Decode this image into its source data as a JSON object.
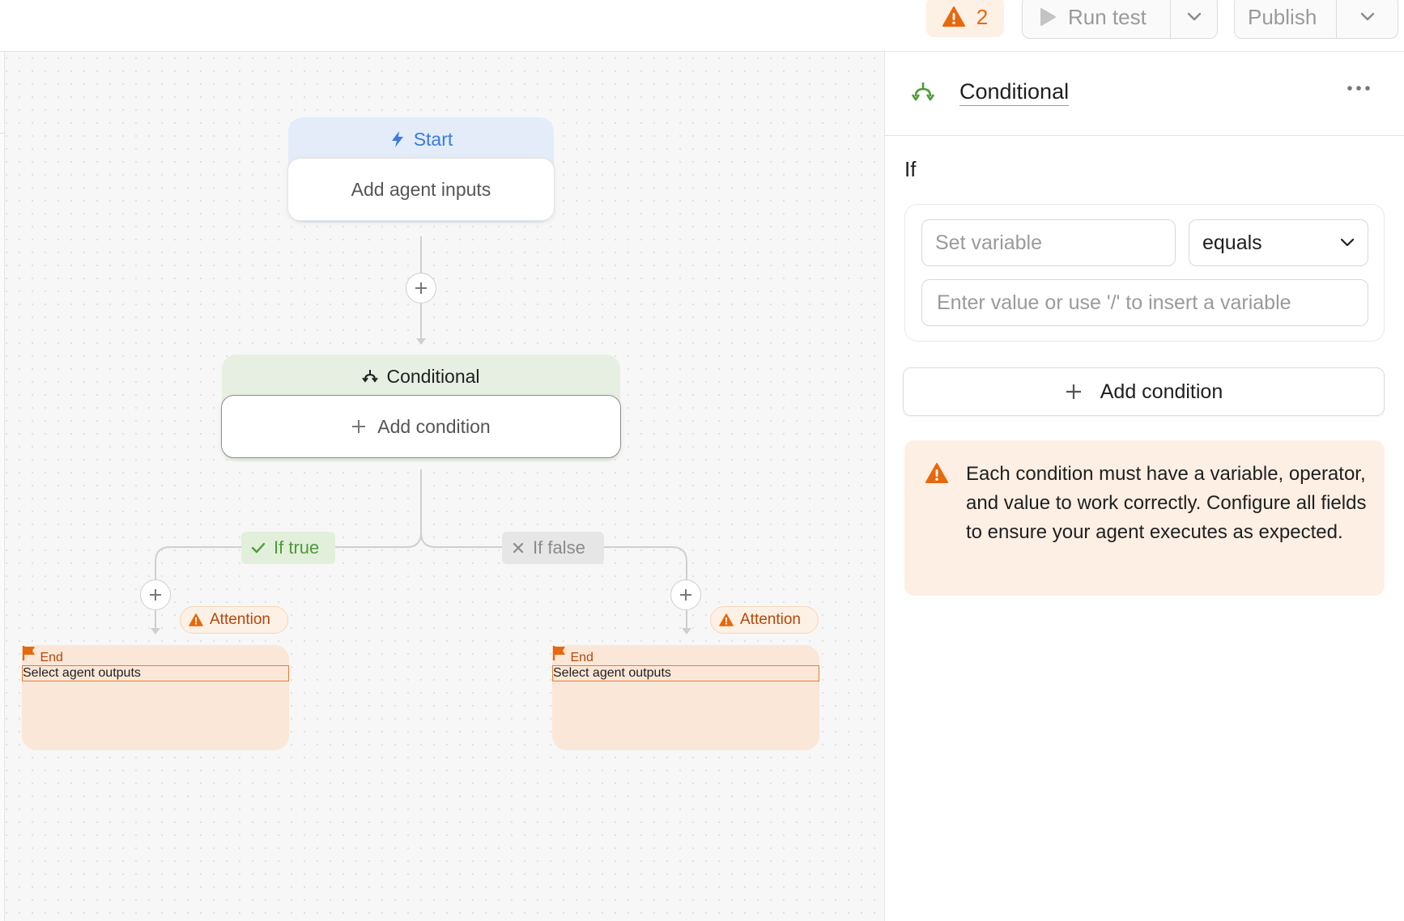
{
  "toolbar": {
    "warning_count": "2",
    "run_test_label": "Run test",
    "publish_label": "Publish"
  },
  "canvas": {
    "start": {
      "title": "Start",
      "body": "Add agent inputs"
    },
    "conditional": {
      "title": "Conditional",
      "body": "Add condition"
    },
    "branches": {
      "true_label": "If true",
      "false_label": "If false"
    },
    "attention_label": "Attention",
    "end_left": {
      "title": "End",
      "body": "Select agent outputs"
    },
    "end_right": {
      "title": "End",
      "body": "Select agent outputs"
    }
  },
  "panel": {
    "title": "Conditional",
    "if_label": "If",
    "variable_placeholder": "Set variable",
    "operator": "equals",
    "value_placeholder": "Enter value or use '/' to insert a variable",
    "add_condition_label": "Add condition",
    "warning_text": "Each condition must have a variable, operator, and value to work correctly. Configure all fields to ensure your agent executes as expected."
  },
  "colors": {
    "accent_orange": "#e8680c",
    "start_blue": "#3b7be0",
    "true_green": "#4e9a3a",
    "end_orange": "#b4470c"
  },
  "icons": {
    "warning": "warning-triangle-icon",
    "play": "play-icon",
    "chevron": "chevron-down-icon",
    "bolt": "lightning-bolt-icon",
    "branch": "branch-split-icon",
    "flag": "flag-icon",
    "check": "check-icon",
    "x": "x-icon",
    "plus": "plus-icon",
    "more": "more-horizontal-icon"
  }
}
